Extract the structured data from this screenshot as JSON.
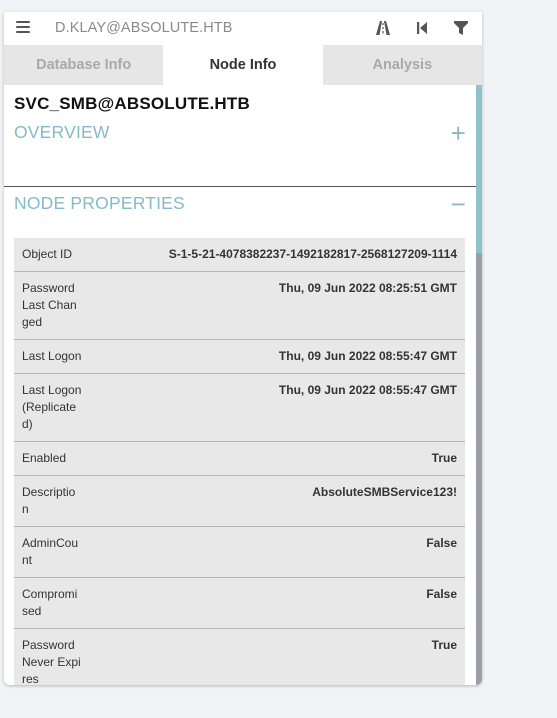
{
  "search": {
    "value": "D.KLAY@ABSOLUTE.HTB"
  },
  "toolbar": {
    "icons": [
      "pathfinding-icon",
      "back-icon",
      "filter-icon"
    ]
  },
  "tabs": [
    {
      "label": "Database Info",
      "active": false
    },
    {
      "label": "Node Info",
      "active": true
    },
    {
      "label": "Analysis",
      "active": false
    }
  ],
  "node": {
    "name": "SVC_SMB@ABSOLUTE.HTB"
  },
  "sections": {
    "overview": {
      "title": "OVERVIEW",
      "toggle": "+"
    },
    "node_properties": {
      "title": "NODE PROPERTIES",
      "toggle": "−"
    }
  },
  "properties": [
    {
      "key": "Object ID",
      "value": "S-1-5-21-4078382237-1492182817-2568127209-1114"
    },
    {
      "key": "Password Last Changed",
      "value": "Thu, 09 Jun 2022 08:25:51 GMT"
    },
    {
      "key": "Last Logon",
      "value": "Thu, 09 Jun 2022 08:55:47 GMT"
    },
    {
      "key": "Last Logon (Replicated)",
      "value": "Thu, 09 Jun 2022 08:55:47 GMT"
    },
    {
      "key": "Enabled",
      "value": "True"
    },
    {
      "key": "Description",
      "value": "AbsoluteSMBService123!"
    },
    {
      "key": "AdminCount",
      "value": "False"
    },
    {
      "key": "Compromised",
      "value": "False"
    },
    {
      "key": "Password Never Expires",
      "value": "True"
    }
  ],
  "colors": {
    "accent": "#86b9c9",
    "row_bg": "#e8e8e8",
    "inactive_tab": "#e6e6e6"
  }
}
